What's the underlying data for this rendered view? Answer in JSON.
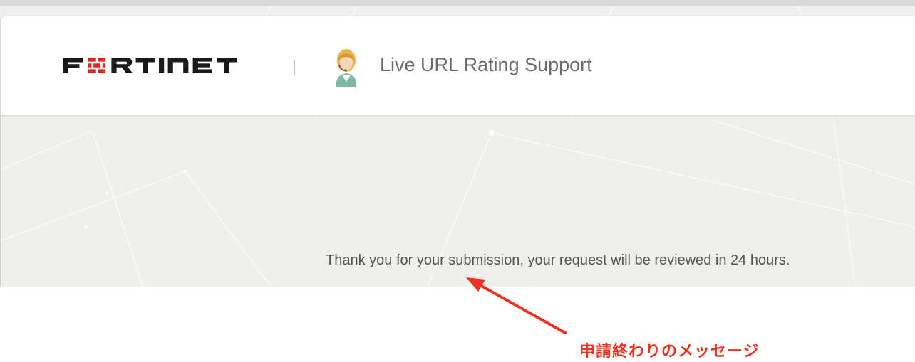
{
  "brand": {
    "name": "FORTINET",
    "color": "#1a1a1a",
    "accent": "#da291c"
  },
  "header": {
    "title": "Live URL Rating Support",
    "avatar_icon": "support-agent-icon"
  },
  "main": {
    "message": "Thank you for your submission, your request will be reviewed in 24 hours."
  },
  "annotation": {
    "text": "申請終わりのメッセージ",
    "color": "#ee3322"
  }
}
